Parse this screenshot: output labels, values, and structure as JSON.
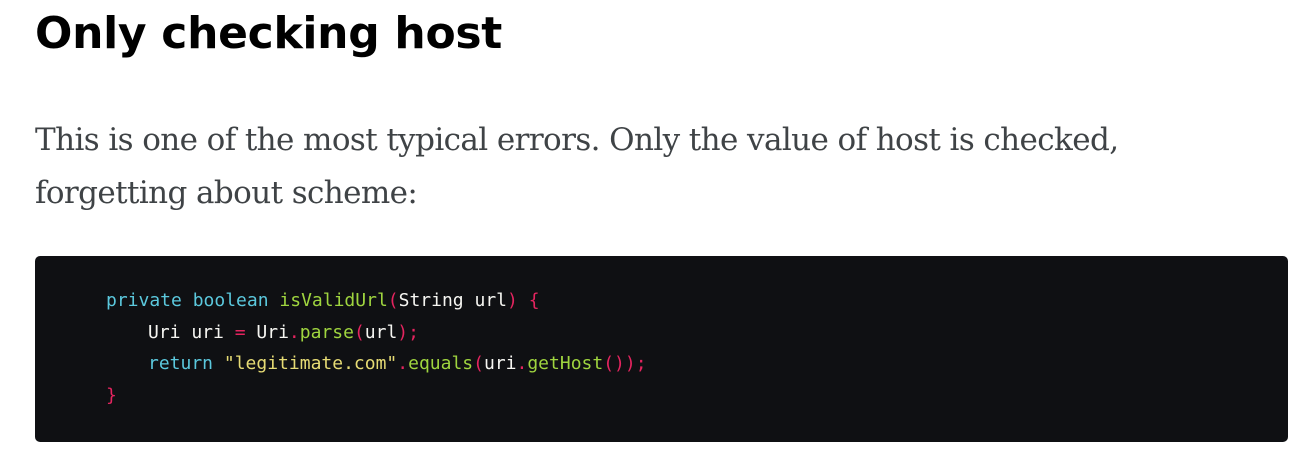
{
  "article": {
    "heading": "Only checking host",
    "paragraph": "This is one of the most typical errors. Only the value of host is checked, forgetting about scheme:"
  },
  "code": {
    "language": "java",
    "line1": {
      "kw1": "private",
      "kw2": "boolean",
      "fn": "isValidUrl",
      "open_paren": "(",
      "params": "String url",
      "close_paren": ")",
      "brace": "{"
    },
    "line2": {
      "decl": "Uri uri",
      "eq": "=",
      "cls": "Uri",
      "dot": ".",
      "fn": "parse",
      "open_paren": "(",
      "arg": "url",
      "close": ");"
    },
    "line3": {
      "kw": "return",
      "str": "\"legitimate.com\"",
      "dot1": ".",
      "fn1": "equals",
      "open_paren": "(",
      "obj": "uri",
      "dot2": ".",
      "fn2": "getHost",
      "close": "());"
    },
    "line4": {
      "brace": "}"
    }
  },
  "colors": {
    "keyword": "#5bc8dd",
    "function": "#9fd53f",
    "punctuation": "#e4245f",
    "string": "#e6db74",
    "code_background": "#0f1013"
  }
}
